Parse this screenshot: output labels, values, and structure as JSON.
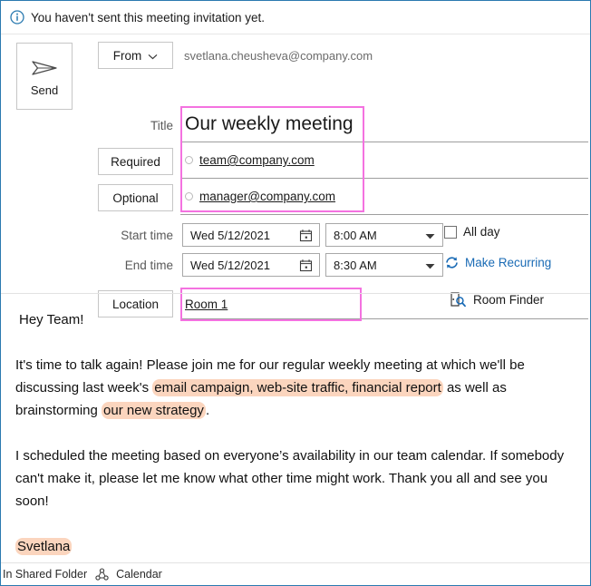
{
  "notice": {
    "icon": "info-circle-icon",
    "text": "You haven't sent this meeting invitation yet."
  },
  "toolbar": {
    "send_label": "Send",
    "send_icon": "paper-plane-icon"
  },
  "form": {
    "from_label": "From",
    "from_chevron": "chevron-down-icon",
    "from_value": "svetlana.cheusheva@company.com",
    "title_label": "Title",
    "title_value": "Our weekly meeting",
    "required_label": "Required",
    "required_value": "team@company.com",
    "optional_label": "Optional",
    "optional_value": "manager@company.com",
    "start_label": "Start time",
    "start_date": "Wed 5/12/2021",
    "start_time": "8:00 AM",
    "end_label": "End time",
    "end_date": "Wed 5/12/2021",
    "end_time": "8:30 AM",
    "calendar_icon": "calendar-icon",
    "dropdown_icon": "caret-down-icon",
    "all_day_label": "All day",
    "all_day_checked": false,
    "recurring_label": "Make Recurring",
    "recurring_icon": "recurrence-arrows-icon",
    "location_label": "Location",
    "location_value": "Room 1",
    "room_finder_label": "Room Finder",
    "room_finder_icon": "room-search-icon"
  },
  "body": {
    "greeting": "Hey Team!",
    "para1_part1": "It's time to talk again! Please join me for our regular weekly meeting at which we'll be discussing last week's ",
    "para1_hl1": "email campaign, web-site traffic, financial report",
    "para1_part2": " as well as brainstorming ",
    "para1_hl2": "our new strategy",
    "para1_part3": ".",
    "para2": "I scheduled the meeting based on everyone’s availability in our team calendar. If somebody can't make it, please let me know what other time might work. Thank you all and see you soon!",
    "signature": "Svetlana"
  },
  "footer": {
    "folder_text": "In Shared Folder",
    "share_icon": "shared-folder-icon",
    "calendar_text": "Calendar"
  },
  "colors": {
    "window_border": "#2a7ab0",
    "accent_link": "#1a6bb5",
    "annotation": "#f472e0",
    "text_highlight": "#fbd5be"
  }
}
